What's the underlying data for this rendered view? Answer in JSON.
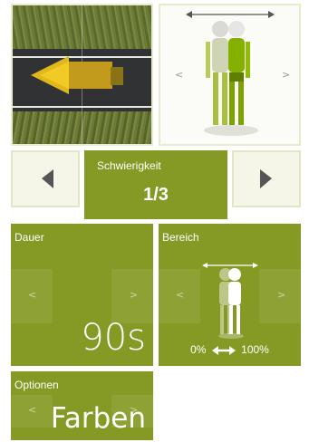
{
  "thumbnails": {
    "road_left_arrow": "<",
    "figure_left_arrow": "<",
    "figure_right_arrow": ">"
  },
  "difficulty": {
    "title": "Schwierigkeit",
    "value": "1/3"
  },
  "duration": {
    "title": "Dauer",
    "value": "90s",
    "left_arrow": "<",
    "right_arrow": ">"
  },
  "range": {
    "title": "Bereich",
    "caption_min": "0%",
    "caption_max": "100%",
    "left_arrow": "<",
    "right_arrow": ">"
  },
  "options": {
    "title": "Optionen",
    "value": "Farben",
    "left_arrow": "<",
    "right_arrow": ">"
  },
  "colors": {
    "tile": "#859a25",
    "tile_border": "#e3e6c4",
    "button_bg": "#f6f6e8",
    "arrow": "#555555"
  },
  "icons": [
    "truck-icon",
    "road-icon",
    "figure-icon",
    "chevron-left-icon",
    "chevron-right-icon",
    "double-arrow-icon"
  ]
}
